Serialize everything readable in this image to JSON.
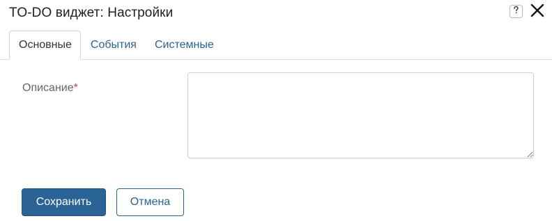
{
  "dialog": {
    "title": "TO-DO виджет: Настройки",
    "help_icon": "help-question-icon",
    "close_icon": "close-icon"
  },
  "tabs": [
    {
      "label": "Основные",
      "active": true
    },
    {
      "label": "События",
      "active": false
    },
    {
      "label": "Системные",
      "active": false
    }
  ],
  "form": {
    "description_label": "Описание",
    "required_mark": "*",
    "description_value": ""
  },
  "actions": {
    "save_label": "Сохранить",
    "cancel_label": "Отмена"
  },
  "colors": {
    "accent": "#2a6496",
    "required": "#d23b3b"
  }
}
